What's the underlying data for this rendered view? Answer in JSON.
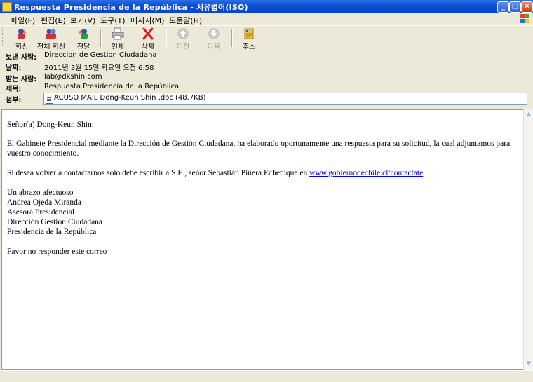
{
  "window": {
    "title": "Respuesta Presidencia de la República - 서유럽어(ISO)",
    "minimize": "_",
    "maximize": "□",
    "close": "✕"
  },
  "menu": [
    "파일(F)",
    "편집(E)",
    "보기(V)",
    "도구(T)",
    "메시지(M)",
    "도움말(H)"
  ],
  "toolbar": {
    "reply": "회신",
    "reply_all": "전체 회신",
    "forward": "전달",
    "print": "인쇄",
    "delete": "삭제",
    "previous": "이전",
    "next": "다음",
    "addresses": "주소"
  },
  "header": {
    "from_label": "보낸 사람:",
    "from": "Direccion de Gestion Ciudadana",
    "date_label": "날짜:",
    "date": "2011년 3월 15일 화요일 오전 6:58",
    "to_label": "받는 사람:",
    "to": "lab@dkshin.com",
    "subject_label": "제목:",
    "subject": "Respuesta Presidencia de la República",
    "attach_label": "첨부:",
    "attachment": "ACUSO MAIL Dong-Keun Shin .doc (48.7KB)"
  },
  "message": {
    "greeting": "Señor(a) Dong-Keun Shin:",
    "para1": "El Gabinete Presidencial mediante la Dirección de Gestión Ciudadana, ha elaborado oportunamente una respuesta para su solicitud, la cual adjuntamos para vuestro conocimiento.",
    "para2_prefix": "Si desea volver a contactarnos solo debe escribir a S.E., señor Sebastián Piñera Echenique en ",
    "link": "www.gobiernodechile.cl/contactate",
    "closing": "Un abrazo afectuoso",
    "signer": "Andrea Ojeda Miranda",
    "role": "Asesora Presidencial",
    "dept": "Dirección Gestión Ciudadana",
    "org": "Presidencia de la República",
    "footer": "Favor no responder este correo"
  },
  "colors": {
    "titlebar": "#0a4fd6",
    "chrome": "#ece9d8",
    "link": "#0000ee",
    "delete_red": "#d42020"
  }
}
